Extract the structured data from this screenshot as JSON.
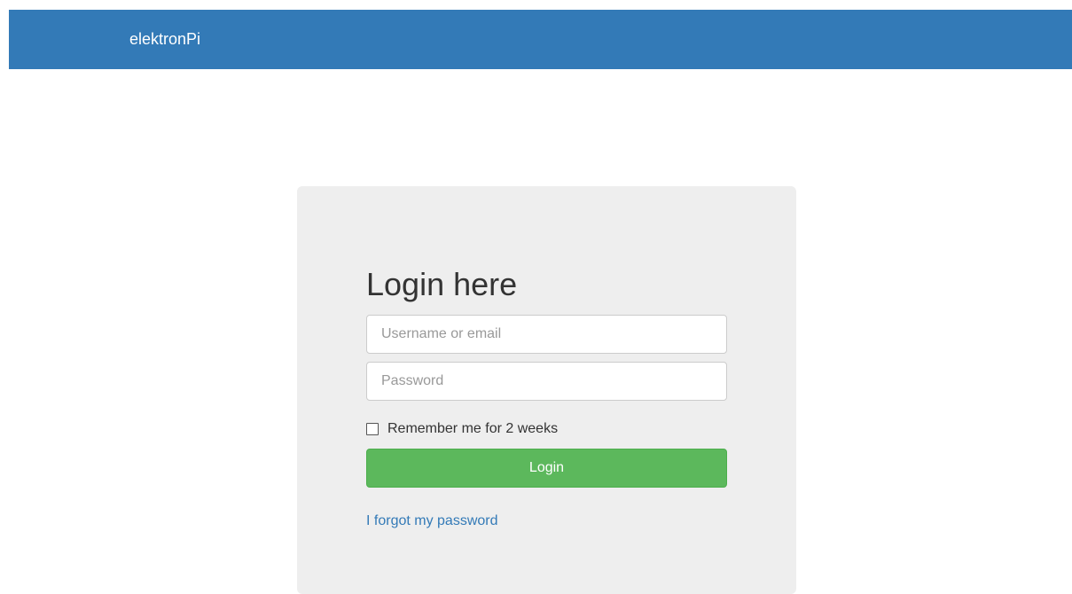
{
  "navbar": {
    "brand": "elektronPi",
    "color": "#337ab7"
  },
  "login": {
    "heading": "Login here",
    "username_placeholder": "Username or email",
    "username_value": "",
    "password_placeholder": "Password",
    "password_value": "",
    "remember_label": "Remember me for 2 weeks",
    "remember_checked": false,
    "button_label": "Login",
    "button_color": "#5cb85c",
    "forgot_link": "I forgot my password"
  }
}
